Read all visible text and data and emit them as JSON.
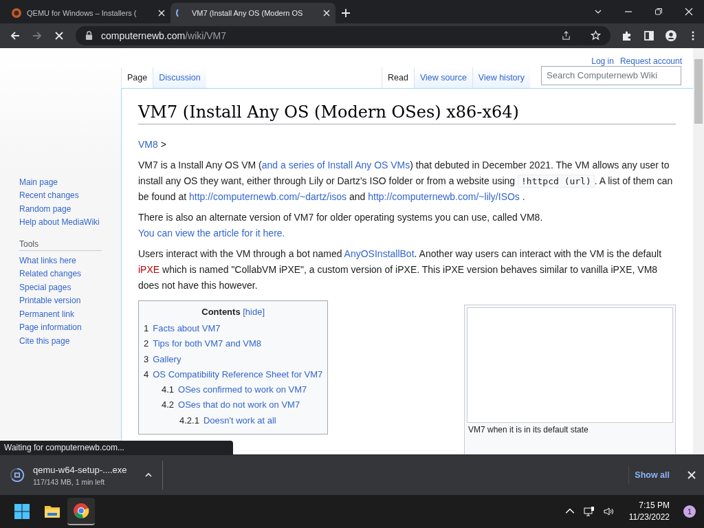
{
  "browser": {
    "tabs": [
      {
        "title": "QEMU for Windows – Installers (",
        "selected": false,
        "loading": false
      },
      {
        "title": "VM7 (Install Any OS (Modern OS",
        "selected": true,
        "loading": true
      }
    ],
    "url_host": "computernewb.com",
    "url_path": "/wiki/VM7",
    "loading": true
  },
  "wiki": {
    "personal": [
      "Log in",
      "Request account"
    ],
    "left_tabs": [
      {
        "label": "Page",
        "selected": true
      },
      {
        "label": "Discussion",
        "selected": false
      }
    ],
    "right_tabs": [
      {
        "label": "Read",
        "selected": true
      },
      {
        "label": "View source",
        "selected": false
      },
      {
        "label": "View history",
        "selected": false
      }
    ],
    "search": {
      "placeholder": "Search Computernewb Wiki"
    },
    "nav": [
      "Main page",
      "Recent changes",
      "Random page",
      "Help about MediaWiki"
    ],
    "tools_heading": "Tools",
    "tools": [
      "What links here",
      "Related changes",
      "Special pages",
      "Printable version",
      "Permanent link",
      "Page information",
      "Cite this page"
    ],
    "title": "VM7 (Install Any OS (Modern OSes) x86-x64)",
    "breadcrumb": [
      {
        "kind": "link",
        "text": "VM8"
      },
      {
        "kind": "plain",
        "text": " >"
      }
    ],
    "paragraphs": [
      [
        {
          "kind": "plain",
          "text": "VM7 is a Install Any OS VM ("
        },
        {
          "kind": "link",
          "text": "and a series of Install Any OS VMs"
        },
        {
          "kind": "plain",
          "text": ") that debuted in December 2021. The VM allows any user to install any OS they want, either through Lily or Dartz's ISO folder or from a website using "
        },
        {
          "kind": "code",
          "text": "!httpcd (url)"
        },
        {
          "kind": "plain",
          "text": ". A list of them can be found at "
        },
        {
          "kind": "link",
          "text": "http://computernewb.com/~dartz/isos"
        },
        {
          "kind": "plain",
          "text": "   and "
        },
        {
          "kind": "link",
          "text": "http://computernewb.com/~lily/ISOs"
        },
        {
          "kind": "plain",
          "text": "   ."
        }
      ],
      [
        {
          "kind": "plain",
          "text": "There is also an alternate version of VM7 for older operating systems you can use, called VM8. "
        },
        {
          "kind": "link",
          "text": "You can view the article for it here."
        }
      ],
      [
        {
          "kind": "plain",
          "text": "Users interact with the VM through a bot named "
        },
        {
          "kind": "link",
          "text": "AnyOSInstallBot"
        },
        {
          "kind": "plain",
          "text": ". Another way users can interact with the VM is the default "
        },
        {
          "kind": "redlink",
          "text": "iPXE"
        },
        {
          "kind": "plain",
          "text": " which is named \"CollabVM iPXE\", a custom version of iPXE. This iPXE version behaves similar to vanilla iPXE, VM8 does not have this however."
        }
      ]
    ],
    "toc": {
      "title": "Contents",
      "toggle": "[hide]",
      "items": [
        {
          "number": "1",
          "text": "Facts about VM7"
        },
        {
          "number": "2",
          "text": "Tips for both VM7 and VM8"
        },
        {
          "number": "3",
          "text": "Gallery"
        },
        {
          "number": "4",
          "text": "OS Compatibility Reference Sheet for VM7",
          "children": [
            {
              "number": "4.1",
              "text": "OSes confirmed to work on VM7"
            },
            {
              "number": "4.2",
              "text": "OSes that do not work on VM7",
              "children": [
                {
                  "number": "4.2.1",
                  "text": "Doesn't work at all"
                }
              ]
            }
          ]
        }
      ]
    },
    "figure": {
      "caption": "VM7 when it is in its default state"
    }
  },
  "status": "Waiting for computernewb.com...",
  "download": {
    "filename": "qemu-w64-setup-....exe",
    "progress": "117/143 MB, 1 min left",
    "show_all": "Show all"
  },
  "taskbar": {
    "time": "7:15 PM",
    "date": "11/23/2022",
    "badge": "1"
  }
}
